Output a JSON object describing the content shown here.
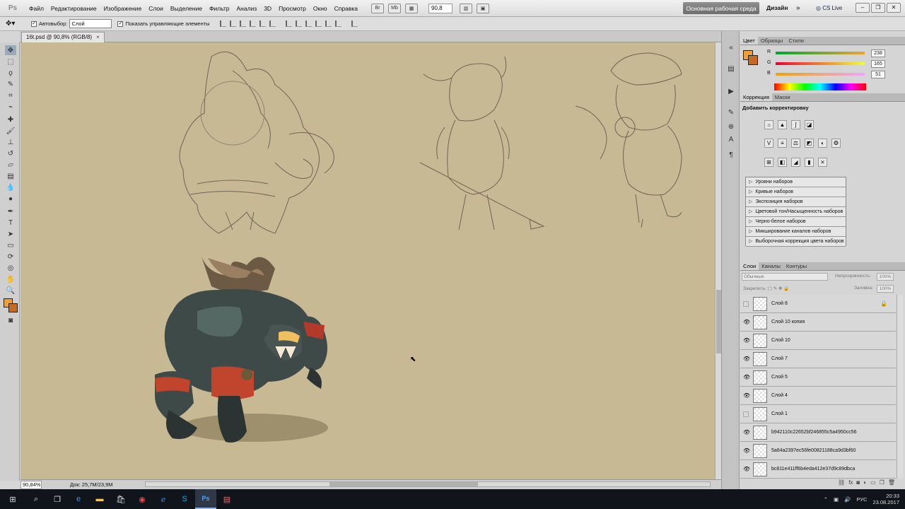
{
  "menubar": {
    "logo": "Ps",
    "items": [
      "Файл",
      "Редактирование",
      "Изображение",
      "Слои",
      "Выделение",
      "Фильтр",
      "Анализ",
      "3D",
      "Просмотр",
      "Окно",
      "Справка"
    ],
    "zoom": "90,8",
    "workspace": "Основная рабочая среда",
    "design": "Дизайн",
    "more": "»",
    "cslive": "CS Live"
  },
  "options": {
    "autoselect_label": "Автовыбор:",
    "autoselect_value": "Слой",
    "show_controls_label": "Показать управляющие элементы"
  },
  "document": {
    "tab_title": "16t.psd @ 90,8% (RGB/8)",
    "close": "×"
  },
  "status": {
    "zoom": "90,84%",
    "doc": "Док: 25,7M/23,9M"
  },
  "panels": {
    "color_tabs": [
      "Цвет",
      "Образцы",
      "Стили"
    ],
    "color": {
      "r_label": "R",
      "g_label": "G",
      "b_label": "B",
      "r": "238",
      "g": "165",
      "b": "51",
      "fg_hex": "#ee9f35",
      "bg_hex": "#c66a21"
    },
    "adjust_tabs": [
      "Коррекция",
      "Маски"
    ],
    "adjust_title": "Добавить корректировку",
    "presets": [
      "Уровни наборов",
      "Кривые наборов",
      "Экспозиция наборов",
      "Цветовой тон/Насыщенность наборов",
      "Черно-белое наборов",
      "Микширование каналов наборов",
      "Выборочная коррекция цвета наборов"
    ],
    "layer_tabs": [
      "Слои",
      "Каналы",
      "Контуры"
    ],
    "blend_mode": "Обычные",
    "opacity_label": "Непрозрачность:",
    "opacity": "100%",
    "lock_label": "Закрепить:",
    "fill_label": "Заливка:",
    "fill": "100%",
    "layers": [
      {
        "name": "Слой 8",
        "visible": false,
        "locked": true
      },
      {
        "name": "Слой 10 копия",
        "visible": true,
        "locked": false
      },
      {
        "name": "Слой 10",
        "visible": true,
        "locked": false
      },
      {
        "name": "Слой 7",
        "visible": true,
        "locked": false
      },
      {
        "name": "Слой 5",
        "visible": true,
        "locked": false
      },
      {
        "name": "Слой 4",
        "visible": true,
        "locked": false
      },
      {
        "name": "Слой 1",
        "visible": false,
        "locked": false
      },
      {
        "name": "b942110c22652bf246855c5a4950cc56",
        "visible": true,
        "locked": false
      },
      {
        "name": "5a64a2397ec56fe00821188ca9d3bf60",
        "visible": true,
        "locked": false
      },
      {
        "name": "bc811e411ff6b4eda412e37d9c89dbca",
        "visible": true,
        "locked": false
      }
    ]
  },
  "taskbar": {
    "lang": "РУС",
    "time": "20:33",
    "date": "23.08.2017"
  }
}
